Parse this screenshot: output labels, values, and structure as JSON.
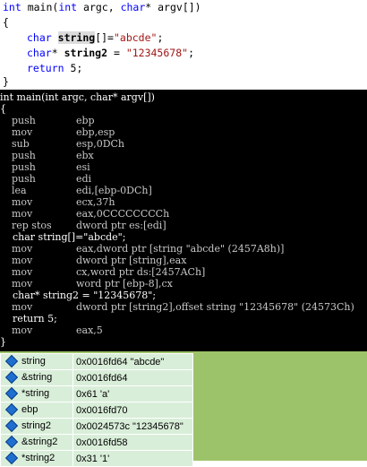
{
  "editor": {
    "line1": {
      "kw1": "int",
      "name": " main(",
      "kw2": "int",
      "rest1": " argc, ",
      "kw3": "char",
      "rest2": "* argv[])"
    },
    "open_brace": "{",
    "line3": {
      "kw": "char",
      "var": "string",
      "rest": "[]=",
      "str": "\"abcde\"",
      "end": ";"
    },
    "line4": {
      "kw": "char",
      "mid": "* ",
      "var": "string2",
      "rest": " = ",
      "str": "\"12345678\"",
      "end": ";"
    },
    "line5": {
      "kw": "return",
      "rest": " 5;"
    },
    "close_brace": "}"
  },
  "disasm": [
    {
      "type": "src",
      "text": "int main(int argc, char* argv[])"
    },
    {
      "type": "src",
      "text": "{"
    },
    {
      "type": "asm",
      "mnemonic": "push",
      "operands": "ebp"
    },
    {
      "type": "asm",
      "mnemonic": "mov",
      "operands": "ebp,esp"
    },
    {
      "type": "asm",
      "mnemonic": "sub",
      "operands": "esp,0DCh"
    },
    {
      "type": "asm",
      "mnemonic": "push",
      "operands": "ebx"
    },
    {
      "type": "asm",
      "mnemonic": "push",
      "operands": "esi"
    },
    {
      "type": "asm",
      "mnemonic": "push",
      "operands": "edi"
    },
    {
      "type": "asm",
      "mnemonic": "lea",
      "operands": "edi,[ebp-0DCh]"
    },
    {
      "type": "asm",
      "mnemonic": "mov",
      "operands": "ecx,37h"
    },
    {
      "type": "asm",
      "mnemonic": "mov",
      "operands": "eax,0CCCCCCCCh"
    },
    {
      "type": "asm",
      "mnemonic": "rep stos",
      "operands": "dword ptr es:[edi]"
    },
    {
      "type": "src",
      "text": "    char string[]=\"abcde\";"
    },
    {
      "type": "asm",
      "mnemonic": "mov",
      "operands": "eax,dword ptr [string \"abcde\" (2457A8h)]"
    },
    {
      "type": "asm",
      "mnemonic": "mov",
      "operands": "dword ptr [string],eax"
    },
    {
      "type": "asm",
      "mnemonic": "mov",
      "operands": "cx,word ptr ds:[2457ACh]"
    },
    {
      "type": "asm",
      "mnemonic": "mov",
      "operands": "word ptr [ebp-8],cx"
    },
    {
      "type": "src",
      "text": "    char* string2 = \"12345678\";"
    },
    {
      "type": "asm",
      "mnemonic": "mov",
      "operands": "dword ptr [string2],offset string \"12345678\" (24573Ch)"
    },
    {
      "type": "src",
      "text": "    return 5;"
    },
    {
      "type": "asm",
      "mnemonic": "mov",
      "operands": "eax,5"
    },
    {
      "type": "src",
      "text": "}"
    }
  ],
  "watch": {
    "icon": "watch-item-icon",
    "rows": [
      {
        "name": "string",
        "value": "0x0016fd64 \"abcde\""
      },
      {
        "name": "&string",
        "value": "0x0016fd64"
      },
      {
        "name": "*string",
        "value": "0x61 'a'"
      },
      {
        "name": "ebp",
        "value": "0x0016fd70"
      },
      {
        "name": "string2",
        "value": "0x0024573c \"12345678\""
      },
      {
        "name": "&string2",
        "value": "0x0016fd58"
      },
      {
        "name": "*string2",
        "value": "0x31 '1'"
      }
    ]
  },
  "colors": {
    "keyword": "#0000ff",
    "string_literal": "#a31515",
    "disasm_bg": "#000000",
    "watch_bg": "#9dc36a",
    "watch_cell": "#d9eed9"
  }
}
